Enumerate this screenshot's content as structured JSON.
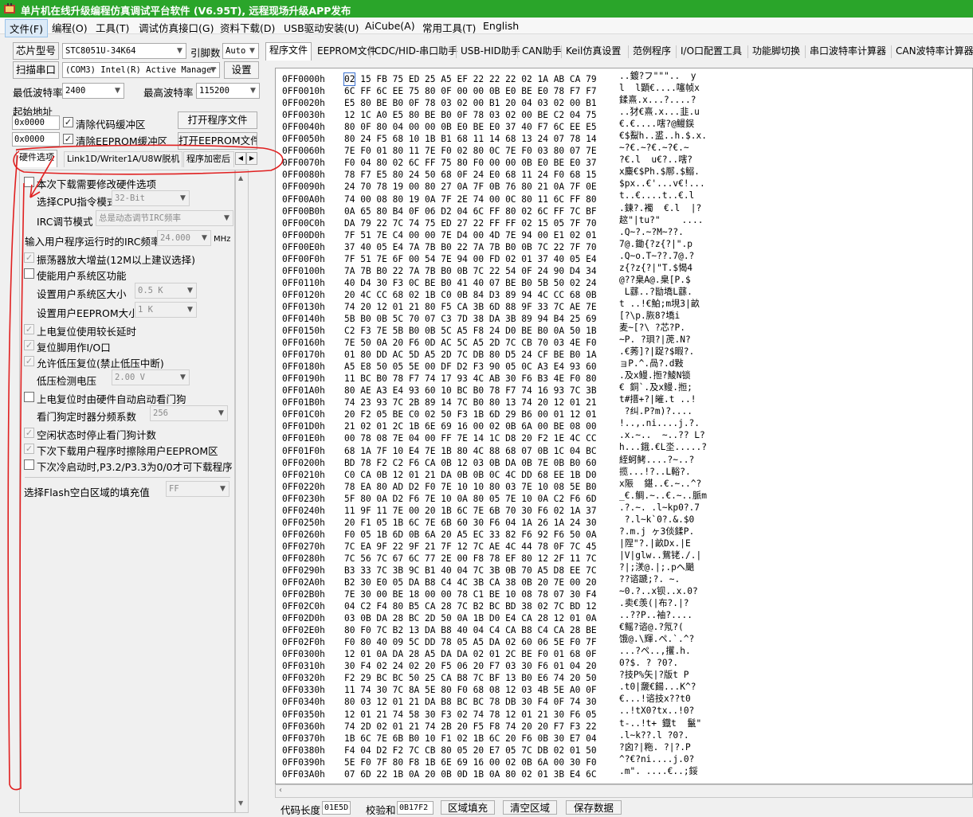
{
  "window": {
    "title": "单片机在线升级编程仿真调试平台软件 (V6.95T), 远程现场升级APP发布",
    "icon": "app-icon"
  },
  "menu": [
    "文件(F)",
    "编程(O)",
    "工具(T)",
    "调试仿真接口(G)",
    "资料下载(D)",
    "USB驱动安装(U)",
    "AiCube(A)",
    "常用工具(T)",
    "English"
  ],
  "left": {
    "chip_model_btn": "芯片型号",
    "chip_model_value": "STC8051U-34K64",
    "pin_count_label": "引脚数",
    "pin_count_value": "Auto",
    "scan_port_btn": "扫描串口",
    "port_value": "(COM3) Intel(R) Active Manager",
    "settings_btn": "设置",
    "min_baud_label": "最低波特率",
    "min_baud_value": "2400",
    "max_baud_label": "最高波特率",
    "max_baud_value": "115200",
    "start_addr_label": "起始地址",
    "code_addr_value": "0x0000",
    "clear_code_buffer_label": "清除代码缓冲区",
    "open_program_btn": "打开程序文件",
    "eeprom_addr_value": "0x0000",
    "clear_eeprom_buffer_label": "清除EEPROM缓冲区",
    "open_eeprom_btn": "打开EEPROM文件",
    "tabs": [
      "硬件选项",
      "Link1D/Writer1A/U8W脱机",
      "程序加密后"
    ],
    "hw": {
      "modify_on_download": "本次下载需要修改硬件选项",
      "cpu_mode_label": "选择CPU指令模式",
      "cpu_mode_value": "32-Bit",
      "irc_mode_label": "IRC调节模式",
      "irc_mode_value": "总是动态调节IRC频率",
      "irc_freq_label": "输入用户程序运行时的IRC频率",
      "irc_freq_value": "24.000",
      "irc_freq_unit": "MHz",
      "osc_gain": "振荡器放大增益(12M以上建议选择)",
      "sys_area_enable": "使能用户系统区功能",
      "sys_area_size_label": "设置用户系统区大小",
      "sys_area_size_value": "0.5 K",
      "eeprom_size_label": "设置用户EEPROM大小",
      "eeprom_size_value": "1  K",
      "long_delay": "上电复位使用较长延时",
      "reset_as_io": "复位脚用作I/O口",
      "lvd_reset": "允许低压复位(禁止低压中断)",
      "lvd_voltage_label": "低压检测电压",
      "lvd_voltage_value": "2.00 V",
      "auto_wdt": "上电复位时由硬件自动启动看门狗",
      "wdt_prescale_label": "看门狗定时器分频系数",
      "wdt_prescale_value": "256",
      "idle_stop_wdt": "空闲状态时停止看门狗计数",
      "erase_eeprom": "下次下载用户程序时擦除用户EEPROM区",
      "p32_p33": "下次冷启动时,P3.2/P3.3为0/0才可下载程序",
      "fill_label": "选择Flash空白区域的填充值",
      "fill_value": "FF"
    }
  },
  "right": {
    "tabs": [
      "程序文件",
      "EEPROM文件",
      "CDC/HID-串口助手",
      "USB-HID助手",
      "CAN助手",
      "Keil仿真设置",
      "范例程序",
      "I/O口配置工具",
      "功能脚切换",
      "串口波特率计算器",
      "CAN波特率计算器"
    ],
    "hex_rows": [
      {
        "addr": "0FF0000h",
        "hex": "02 15 FB 75 ED 25 A5 EF 22 22 22 02 1A AB CA 79",
        "ascii": "..鍍?フ\"\"\"..  y"
      },
      {
        "addr": "0FF0010h",
        "hex": "6C FF 6C EE 75 80 0F 00 00 0B E0 BE E0 78 F7 F7",
        "ascii": "l  l顕€....噻帧x"
      },
      {
        "addr": "0FF0020h",
        "hex": "E5 80 BE B0 0F 78 03 02 00 B1 20 04 03 02 00 B1",
        "ascii": "鍒熹.x...?....?"
      },
      {
        "addr": "0FF0030h",
        "hex": "12 1C A0 E5 80 BE B0 0F 78 03 02 00 BE C2 04 75",
        "ascii": "..犲€熹.x...韭.u"
      },
      {
        "addr": "0FF0040h",
        "hex": "80 0F 80 04 00 00 0B E0 BE E0 37 40 F7 6C EE E5",
        "ascii": "€.€....嗐?@鰻鋘"
      },
      {
        "addr": "0FF0050h",
        "hex": "80 24 F5 68 10 1B B1 68 11 14 68 13 24 07 78 14",
        "ascii": "€$鮤h..盚..h.$.x."
      },
      {
        "addr": "0FF0060h",
        "hex": "7E F0 01 80 11 7E F0 02 80 0C 7E F0 03 80 07 7E",
        "ascii": "~?€.~?€.~?€.~"
      },
      {
        "addr": "0FF0070h",
        "hex": "F0 04 80 02 6C FF 75 80 F0 00 00 0B E0 BE E0 37",
        "ascii": "?€.l  u€?..嗐?"
      },
      {
        "addr": "0FF0080h",
        "hex": "78 F7 E5 80 24 50 68 0F 24 E0 68 11 24 F0 68 15",
        "ascii": "x麋€$Ph.$鄏.$鰯."
      },
      {
        "addr": "0FF0090h",
        "hex": "24 70 78 19 00 80 27 0A 7F 0B 76 80 21 0A 7F 0E",
        "ascii": "$px..€'...v€!..."
      },
      {
        "addr": "0FF00A0h",
        "hex": "74 00 08 80 19 0A 7F 2E 74 00 0C 80 11 6C FF 80",
        "ascii": "t..€....t..€.l  "
      },
      {
        "addr": "0FF00B0h",
        "hex": "0A 65 80 B4 0F 06 D2 04 6C FF 80 02 6C FF 7C BF",
        "ascii": ".鍊?.襡  €.l  |?"
      },
      {
        "addr": "0FF00C0h",
        "hex": "DA 79 22 7C 74 75 ED 27 22 FF FF 02 15 05 7F 70",
        "ascii": "趑\"|tu?\"    ...."
      },
      {
        "addr": "0FF00D0h",
        "hex": "7F 51 7E C4 00 00 7E D4 00 4D 7E 94 00 E1 02 01",
        "ascii": ".Q~?.~?M~??."
      },
      {
        "addr": "0FF00E0h",
        "hex": "37 40 05 E4 7A 7B B0 22 7A 7B B0 0B 7C 22 7F 70",
        "ascii": "7@.鋤{?z{?|\".p"
      },
      {
        "addr": "0FF00F0h",
        "hex": "7F 51 7E 6F 00 54 7E 94 00 FD 02 01 37 40 05 E4",
        "ascii": ".Q~o.T~??.7@.?"
      },
      {
        "addr": "0FF0100h",
        "hex": "7A 7B B0 22 7A 7B B0 0B 7C 22 54 0F 24 90 D4 34",
        "ascii": "z{?z{?|\"T.$愒4"
      },
      {
        "addr": "0FF0110h",
        "hex": "40 D4 30 F3 0C BE B0 41 40 07 BE B0 5B 50 02 24",
        "ascii": "@??臬A@.臬[P.$"
      },
      {
        "addr": "0FF0120h",
        "hex": "20 4C CC 68 02 1B C0 0B 84 D3 89 94 4C CC 68 0B",
        "ascii": " L蘨..?勓墧L蘨."
      },
      {
        "addr": "0FF0130h",
        "hex": "74 20 12 01 21 80 F5 CA 3B 6D 88 9F 33 7C AE 7E",
        "ascii": "t ..!€鮊;m垷3|畝"
      },
      {
        "addr": "0FF0140h",
        "hex": "5B B0 0B 5C 70 07 C3 7D 38 DA 3B 89 94 B4 25 69",
        "ascii": "[?\\p.脄8?墧i"
      },
      {
        "addr": "0FF0150h",
        "hex": "C2 F3 7E 5B B0 0B 5C A5 F8 24 D0 BE B0 0A 50 1B",
        "ascii": "麦~[?\\ ?芯?P."
      },
      {
        "addr": "0FF0160h",
        "hex": "7E 50 0A 20 F6 0D AC 5C A5 2D 7C CB 70 03 4E F0",
        "ascii": "~P. ?珼?|萀.N?"
      },
      {
        "addr": "0FF0170h",
        "hex": "01 80 DD AC 5D A5 2D 7C DB 80 D5 24 CF BE B0 1A",
        "ascii": ".€莠]?|踀?$暇?."
      },
      {
        "addr": "0FF0180h",
        "hex": "A5 E8 50 05 5E 00 DF D2 F3 90 05 0C A3 E4 93 60",
        "ascii": "ョP.^.咼?.d敤"
      },
      {
        "addr": "0FF0190h",
        "hex": "11 BC B0 78 F7 74 17 93 4C AB 30 F6 B3 4E F0 80",
        "ascii": ".及x鳗.搄?鯪N锁"
      },
      {
        "addr": "0FF01A0h",
        "hex": "80 AE A3 E4 93 60 10 BC B0 78 F7 74 16 93 7C 3B",
        "ascii": "€ 銅`.及x鳗.搄;"
      },
      {
        "addr": "0FF01B0h",
        "hex": "74 23 93 7C 2B 89 14 7C B0 80 13 74 20 12 01 21",
        "ascii": "t#搢+?|皠.t ..!"
      },
      {
        "addr": "0FF01C0h",
        "hex": "20 F2 05 BE C0 02 50 F3 1B 6D 29 B6 00 01 12 01",
        "ascii": " ?纠.P?m)?...."
      },
      {
        "addr": "0FF01D0h",
        "hex": "21 02 01 2C 1B 6E 69 16 00 02 0B 6A 00 BE 08 00",
        "ascii": "!..,.ni....j.?."
      },
      {
        "addr": "0FF01E0h",
        "hex": "00 78 08 7E 04 00 FF 7E 14 1C D8 20 F2 1E 4C CC",
        "ascii": ".x.~..  ~..?? L?"
      },
      {
        "addr": "0FF01F0h",
        "hex": "68 1A 7F 10 E4 7E 1B 80 4C 88 68 07 0B 1C 04 BC",
        "ascii": "h...鋨.€L坔.....?"
      },
      {
        "addr": "0FF0200h",
        "hex": "BD 78 F2 C2 F6 CA 0B 12 03 0B DA 0B 7E 0B B0 60",
        "ascii": "絰蚵鲓....?~..?"
      },
      {
        "addr": "0FF0210h",
        "hex": "C0 CA 0B 12 01 21 DA 0B 0B 0C 4C DD 68 EE 1B D0",
        "ascii": "揽...!?..L輍?."
      },
      {
        "addr": "0FF0220h",
        "hex": "78 EA 80 AD D2 F0 7E 10 10 80 03 7E 10 08 5E B0",
        "ascii": "x陙  鍖..€.~..^?"
      },
      {
        "addr": "0FF0230h",
        "hex": "5F 80 0A D2 F6 7E 10 0A 80 05 7E 10 0A C2 F6 6D",
        "ascii": "_€.鲷.~..€.~..脈m"
      },
      {
        "addr": "0FF0240h",
        "hex": "11 9F 11 7E 00 20 1B 6C 7E 6B 70 30 F6 02 1A 37",
        "ascii": ".?.~. .l~kp0?.7"
      },
      {
        "addr": "0FF0250h",
        "hex": "20 F1 05 1B 6C 7E 6B 60 30 F6 04 1A 26 1A 24 30",
        "ascii": " ?.l~k`0?.&.$0"
      },
      {
        "addr": "0FF0260h",
        "hex": "F0 05 1B 6D 0B 6A 20 A5 EC 33 82 F6 92 F6 50 0A",
        "ascii": "?.m.j ヶ3倓鍒P."
      },
      {
        "addr": "0FF0270h",
        "hex": "7C EA 9F 22 9F 21 7F 12 7C AE 4C 44 78 0F 7C 45",
        "ascii": "|陧\"?.|畝Dx.|E"
      },
      {
        "addr": "0FF0280h",
        "hex": "7C 56 7C 67 6C 77 2E 00 F8 78 EF 80 12 2F 11 7C",
        "ascii": "|V|glw..鴛铑./.|"
      },
      {
        "addr": "0FF0290h",
        "hex": "B3 33 7C 3B 9C B1 40 04 7C 3B 0B 70 A5 D8 EE 7C",
        "ascii": "?|;湵@.|;.pヘ颵"
      },
      {
        "addr": "0FF02A0h",
        "hex": "B2 30 E0 05 DA B8 C4 4C 3B CA 38 0B 20 7E 00 20",
        "ascii": "??谘蹏;?. ~. "
      },
      {
        "addr": "0FF02B0h",
        "hex": "7E 30 00 BE 18 00 00 78 C1 BE 10 08 78 07 30 F4",
        "ascii": "~0.?..x钡..x.0?"
      },
      {
        "addr": "0FF02C0h",
        "hex": "04 C2 F4 80 B5 CA 28 7C B2 BC BD 38 02 7C BD 12",
        "ascii": ".卖€羡(|布?.|?"
      },
      {
        "addr": "0FF02D0h",
        "hex": "03 0B DA 28 BC 2D 50 0A 1B D0 E4 CA 28 12 01 0A",
        "ascii": "..??P..袖?...."
      },
      {
        "addr": "0FF02E0h",
        "hex": "80 F0 7C B2 13 DA B8 40 04 C4 CA B8 C4 CA 28 BE",
        "ascii": "€鳐?谘@.?氖?("
      },
      {
        "addr": "0FF02F0h",
        "hex": "F0 80 40 09 5C DD 78 05 A5 DA 02 60 06 5E F0 7F",
        "ascii": "饿@.\\輝.ペ.`.^?"
      },
      {
        "addr": "0FF0300h",
        "hex": "12 01 0A DA 28 A5 DA DA 02 01 2C BE F0 01 68 0F",
        "ascii": "...?ペ..,攫.h."
      },
      {
        "addr": "0FF0310h",
        "hex": "30 F4 02 24 02 20 F5 06 20 F7 03 30 F6 01 04 20",
        "ascii": "0?$. ? ?0?. "
      },
      {
        "addr": "0FF0320h",
        "hex": "F2 29 BC BC 50 25 CA B8 7C BF 13 B0 E6 74 20 50",
        "ascii": "?技P%矢|?版t P"
      },
      {
        "addr": "0FF0330h",
        "hex": "11 74 30 7C 8A 5E 80 F0 68 08 12 03 4B 5E A0 0F",
        "ascii": ".t0|奯€餳...K^?"
      },
      {
        "addr": "0FF0340h",
        "hex": "80 03 12 01 21 DA B8 BC BC 78 DB 30 F4 0F 74 30",
        "ascii": "€...!谘技x??t0"
      },
      {
        "addr": "0FF0350h",
        "hex": "12 01 21 74 58 30 F3 02 74 78 12 01 21 30 F6 05",
        "ascii": "..!tX0?tx..!0?"
      },
      {
        "addr": "0FF0360h",
        "hex": "74 2D 02 01 21 74 2B 20 F5 F8 74 20 20 F7 F3 22",
        "ascii": "t-..!t+ 鐡t  鬣\""
      },
      {
        "addr": "0FF0370h",
        "hex": "1B 6C 7E 6B B0 10 F1 02 1B 6C 20 F6 0B 30 E7 04",
        "ascii": ".l~k??.l ?0?."
      },
      {
        "addr": "0FF0380h",
        "hex": "F4 04 D2 F2 7C CB 80 05 20 E7 05 7C DB 02 01 50",
        "ascii": "?囟?|粚. ?|?.P"
      },
      {
        "addr": "0FF0390h",
        "hex": "5E F0 7F 80 F8 1B 6E 69 16 00 02 0B 6A 00 30 F0",
        "ascii": "^?€?ni....j.0?"
      },
      {
        "addr": "0FF03A0h",
        "hex": "07 6D 22 1B 0A 20 0B 0D 1B 0A 80 02 01 3B E4 6C",
        "ascii": ".m\". ....€..;鋖"
      }
    ]
  },
  "bottom": {
    "code_len_label": "代码长度",
    "code_len_value": "01E5D",
    "checksum_label": "校验和",
    "checksum_value": "0B17F2",
    "fill_area_btn": "区域填充",
    "clear_area_btn": "清空区域",
    "save_data_btn": "保存数据"
  },
  "colors": {
    "titlebar": "#2aa52a",
    "annotation": "#e02020",
    "selection": "#3a70d0"
  }
}
